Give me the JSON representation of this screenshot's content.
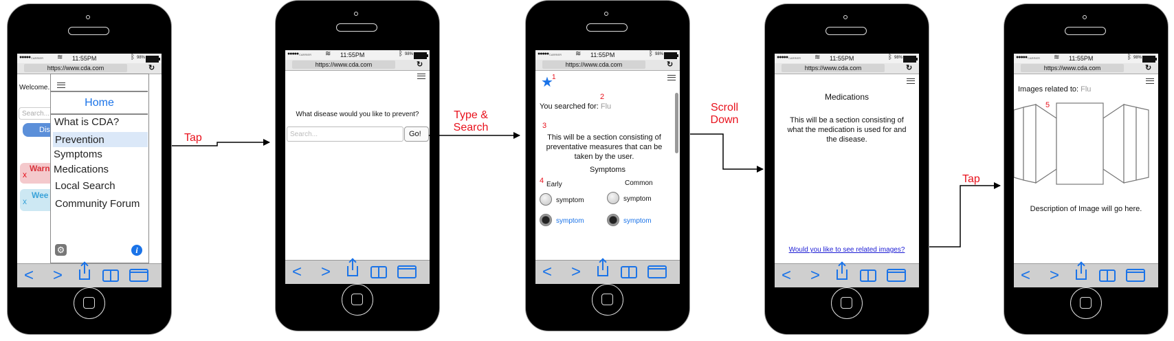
{
  "status": {
    "carrier": "CARRIER",
    "time": "11:55PM",
    "battery": "98%",
    "url": "https://www.cda.com"
  },
  "arrows": {
    "tap1": "Tap",
    "type_search": "Type & Search",
    "scroll_down": "Scroll Down",
    "tap2": "Tap"
  },
  "screen1": {
    "welcome": "Welcome.",
    "search_placeholder": "Search...",
    "button_partial": "Dis",
    "alert_red": "Warn",
    "alert_blue": "Wee",
    "menu": {
      "home": "Home",
      "items": [
        "What is CDA?",
        "Prevention",
        "Symptoms",
        "Medications",
        "Local Search",
        "Community Forum"
      ]
    }
  },
  "screen2": {
    "question": "What disease would you like to prevent?",
    "search_placeholder": "Search...",
    "go": "Go!"
  },
  "screen3": {
    "marker1": "1",
    "marker2": "2",
    "marker3": "3",
    "marker4": "4",
    "searched_for": "You searched for:",
    "query": "Flu",
    "description": "This will be a section consisting of preventative measures that can be taken by the user.",
    "symptoms_heading": "Symptoms",
    "col_early": "Early",
    "col_common": "Common",
    "symptom": "symptom"
  },
  "screen4": {
    "heading": "Medications",
    "description": "This will be a section consisting of what the medication is used for and the disease.",
    "link": "Would you like to see related images?"
  },
  "screen5": {
    "images_related": "Images related to:",
    "query": "Flu",
    "marker5": "5",
    "caption": "Description of Image will go here."
  }
}
